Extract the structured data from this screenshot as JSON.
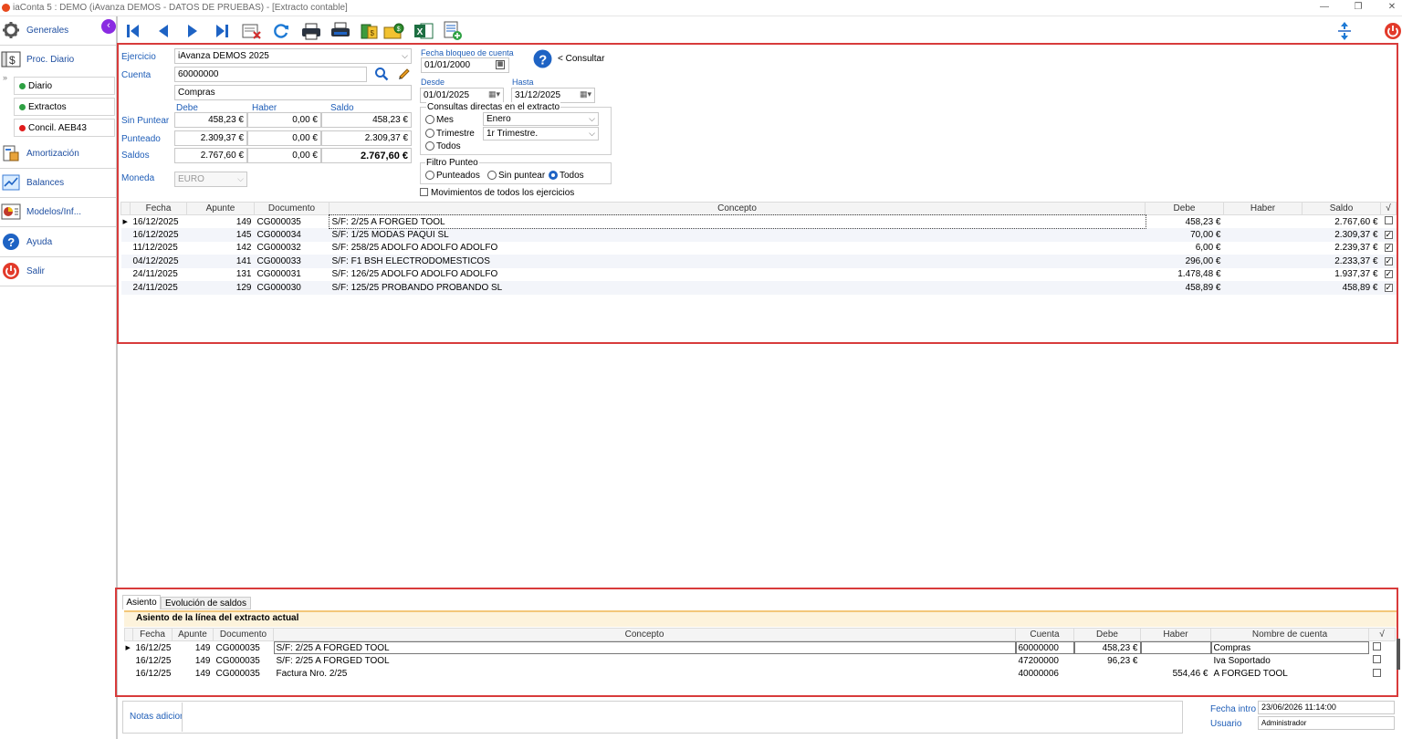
{
  "window": {
    "title": "iaConta 5 : DEMO (iAvanza DEMOS - DATOS DE PRUEBAS) - [Extracto contable]",
    "minimize": "—",
    "restore": "❐",
    "close": "✕"
  },
  "sidebar": {
    "items": [
      {
        "label": "Generales",
        "icon": "gear-icon"
      },
      {
        "label": "Proc. Diario",
        "icon": "ledger-icon"
      },
      {
        "label": "Amortización",
        "icon": "amortization-icon"
      },
      {
        "label": "Balances",
        "icon": "chart-icon"
      },
      {
        "label": "Modelos/Inf...",
        "icon": "pie-report-icon"
      },
      {
        "label": "Ayuda",
        "icon": "help-icon"
      },
      {
        "label": "Salir",
        "icon": "power-icon"
      }
    ],
    "sub_items": [
      {
        "label": "Diario",
        "status_color": "#2ea043"
      },
      {
        "label": "Extractos",
        "status_color": "#2ea043"
      },
      {
        "label": "Concil. AEB43",
        "status_color": "#e01b1b"
      }
    ],
    "expand_glyph": "»",
    "collapse_glyph": "‹"
  },
  "toolbar": {
    "buttons": [
      "first-record-icon",
      "prev-record-icon",
      "next-record-icon",
      "last-record-icon",
      "delete-doc-icon",
      "refresh-icon",
      "print-icon",
      "print-preview-icon",
      "cash-icon",
      "money-folder-icon",
      "excel-icon",
      "report-add-icon"
    ],
    "accent": "#1e63c4"
  },
  "form": {
    "ejercicio_label": "Ejercicio",
    "ejercicio_value": "iAvanza DEMOS 2025",
    "cuenta_label": "Cuenta",
    "cuenta_value": "60000000",
    "cuenta_name": "Compras",
    "col_debe": "Debe",
    "col_haber": "Haber",
    "col_saldo": "Saldo",
    "rows": [
      {
        "label": "Sin Puntear",
        "debe": "458,23 €",
        "haber": "0,00 €",
        "saldo": "458,23 €"
      },
      {
        "label": "Punteado",
        "debe": "2.309,37 €",
        "haber": "0,00 €",
        "saldo": "2.309,37 €"
      },
      {
        "label": "Saldos",
        "debe": "2.767,60 €",
        "haber": "0,00 €",
        "saldo": "2.767,60 €"
      }
    ],
    "moneda_label": "Moneda",
    "moneda_value": "EURO",
    "bloqueo_label": "Fecha bloqueo de cuenta",
    "bloqueo_value": "01/01/2000",
    "desde_label": "Desde",
    "desde_value": "01/01/2025",
    "hasta_label": "Hasta",
    "hasta_value": "31/12/2025",
    "consultar_label": "< Consultar",
    "consultas_title": "Consultas directas en el extracto",
    "mes_label": "Mes",
    "mes_value": "Enero",
    "trimestre_label": "Trimestre",
    "trimestre_value": "1r Trimestre.",
    "todos_label": "Todos",
    "filtro_title": "Filtro Punteo",
    "filtro_punteados": "Punteados",
    "filtro_sin": "Sin puntear",
    "filtro_todos": "Todos",
    "movimientos_label": "Movimientos de todos los ejercicios"
  },
  "extract_table": {
    "headers": [
      "Fecha",
      "Apunte",
      "Documento",
      "Concepto",
      "Debe",
      "Haber",
      "Saldo",
      "√"
    ],
    "rows": [
      {
        "fecha": "16/12/2025",
        "apunte": "149",
        "documento": "CG000035",
        "concepto": "S/F: 2/25 A FORGED TOOL",
        "debe": "458,23 €",
        "haber": "",
        "saldo": "2.767,60 €",
        "checked": false
      },
      {
        "fecha": "16/12/2025",
        "apunte": "145",
        "documento": "CG000034",
        "concepto": "S/F: 1/25 MODAS PAQUI SL",
        "debe": "70,00 €",
        "haber": "",
        "saldo": "2.309,37 €",
        "checked": true
      },
      {
        "fecha": "11/12/2025",
        "apunte": "142",
        "documento": "CG000032",
        "concepto": "S/F: 258/25 ADOLFO ADOLFO ADOLFO",
        "debe": "6,00 €",
        "haber": "",
        "saldo": "2.239,37 €",
        "checked": true
      },
      {
        "fecha": "04/12/2025",
        "apunte": "141",
        "documento": "CG000033",
        "concepto": "S/F: F1 BSH ELECTRODOMESTICOS",
        "debe": "296,00 €",
        "haber": "",
        "saldo": "2.233,37 €",
        "checked": true
      },
      {
        "fecha": "24/11/2025",
        "apunte": "131",
        "documento": "CG000031",
        "concepto": "S/F: 126/25 ADOLFO ADOLFO ADOLFO",
        "debe": "1.478,48 €",
        "haber": "",
        "saldo": "1.937,37 €",
        "checked": true
      },
      {
        "fecha": "24/11/2025",
        "apunte": "129",
        "documento": "CG000030",
        "concepto": "S/F: 125/25 PROBANDO PROBANDO SL",
        "debe": "458,89 €",
        "haber": "",
        "saldo": "458,89 €",
        "checked": true
      }
    ]
  },
  "bottom": {
    "tabs": [
      "Asiento",
      "Evolución de saldos"
    ],
    "section_title": "Asiento de la línea del extracto actual",
    "headers": [
      "Fecha",
      "Apunte",
      "Documento",
      "Concepto",
      "Cuenta",
      "Debe",
      "Haber",
      "Nombre de cuenta",
      "√"
    ],
    "rows": [
      {
        "fecha": "16/12/25",
        "apunte": "149",
        "documento": "CG000035",
        "concepto": "S/F: 2/25 A FORGED TOOL",
        "cuenta": "60000000",
        "debe": "458,23 €",
        "haber": "",
        "nombre": "Compras"
      },
      {
        "fecha": "16/12/25",
        "apunte": "149",
        "documento": "CG000035",
        "concepto": "S/F: 2/25 A FORGED TOOL",
        "cuenta": "47200000",
        "debe": "96,23 €",
        "haber": "",
        "nombre": "Iva Soportado"
      },
      {
        "fecha": "16/12/25",
        "apunte": "149",
        "documento": "CG000035",
        "concepto": "Factura Nro. 2/25",
        "cuenta": "40000006",
        "debe": "",
        "haber": "554,46 €",
        "nombre": "A FORGED TOOL"
      }
    ],
    "notas_label": "Notas adicionales",
    "fecha_intro_label": "Fecha intro",
    "fecha_intro_value": "23/06/2026 11:14:00",
    "usuario_label": "Usuario",
    "usuario_value": "Administrador"
  }
}
